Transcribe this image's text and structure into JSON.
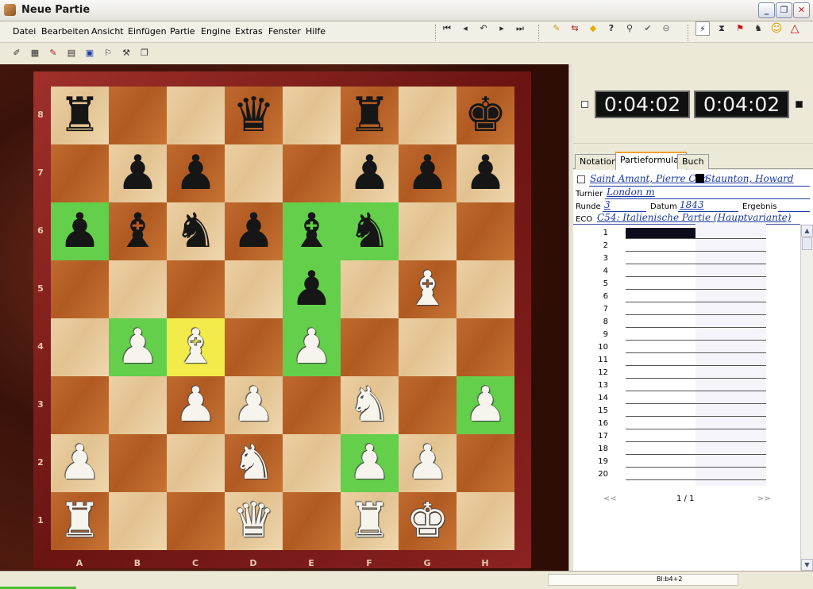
{
  "window": {
    "title": "Neue Partie",
    "min_glyph": "_",
    "max_glyph": "❐",
    "close_glyph": "✕"
  },
  "menu": [
    "Datei",
    "Bearbeiten",
    "Ansicht",
    "Einfügen",
    "Partie",
    "Engine",
    "Extras",
    "Fenster",
    "Hilfe"
  ],
  "nav_icons": [
    {
      "name": "first-move",
      "glyph": "⏮"
    },
    {
      "name": "prev-move",
      "glyph": "◂"
    },
    {
      "name": "takeback",
      "glyph": "↶"
    },
    {
      "name": "next-move",
      "glyph": "▸"
    },
    {
      "name": "last-move",
      "glyph": "⏭"
    }
  ],
  "tool_icons": [
    {
      "name": "new-game",
      "glyph": "✎"
    },
    {
      "name": "flip",
      "glyph": "⇆"
    },
    {
      "name": "hint",
      "glyph": "◆"
    },
    {
      "name": "analysis",
      "glyph": "?"
    },
    {
      "name": "search",
      "glyph": "⚲"
    },
    {
      "name": "accept",
      "glyph": "✔"
    },
    {
      "name": "resign",
      "glyph": "⊖"
    }
  ],
  "right_icons": [
    {
      "name": "engine",
      "glyph": "⚡"
    },
    {
      "name": "hourglass",
      "glyph": "⧗"
    },
    {
      "name": "flag",
      "glyph": "⚑"
    },
    {
      "name": "trainer",
      "glyph": "♞"
    },
    {
      "name": "smiley",
      "glyph": "☺"
    },
    {
      "name": "triangle",
      "glyph": "△"
    }
  ],
  "toolbar2_icons": [
    "✐",
    "▦",
    "✎",
    "▤",
    "▣",
    "⚐",
    "⚒",
    "❐"
  ],
  "board": {
    "ranks": [
      "8",
      "7",
      "6",
      "5",
      "4",
      "3",
      "2",
      "1"
    ],
    "files": [
      "A",
      "B",
      "C",
      "D",
      "E",
      "F",
      "G",
      "H"
    ],
    "rows": [
      [
        "bR",
        "",
        "",
        "bQ",
        "",
        "bR",
        "",
        "bK"
      ],
      [
        "",
        "bP",
        "bP",
        "",
        "",
        "bP",
        "bP",
        "bP"
      ],
      [
        "bP",
        "bB",
        "bN",
        "bP",
        "bB",
        "bN",
        "",
        ""
      ],
      [
        "",
        "",
        "",
        "",
        "bP",
        "",
        "wB",
        ""
      ],
      [
        "",
        "wP",
        "wB",
        "",
        "wP",
        "",
        "",
        ""
      ],
      [
        "",
        "",
        "wP",
        "wP",
        "",
        "wN",
        "",
        "wP"
      ],
      [
        "wP",
        "",
        "",
        "wN",
        "",
        "wP",
        "wP",
        ""
      ],
      [
        "wR",
        "",
        "",
        "wQ",
        "",
        "wR",
        "wK",
        ""
      ]
    ],
    "highlights": [
      {
        "sq": "a6",
        "color": "green"
      },
      {
        "sq": "b4",
        "color": "green"
      },
      {
        "sq": "c4",
        "color": "yellow"
      },
      {
        "sq": "e6",
        "color": "green"
      },
      {
        "sq": "e5",
        "color": "green"
      },
      {
        "sq": "e4",
        "color": "green"
      },
      {
        "sq": "f6",
        "color": "green"
      },
      {
        "sq": "f2",
        "color": "green"
      },
      {
        "sq": "h3",
        "color": "green"
      }
    ]
  },
  "clocks": {
    "white": "0:04:02",
    "black": "0:04:02"
  },
  "tabs": [
    "Notation",
    "Partieformular",
    "Buch"
  ],
  "active_tab": 1,
  "form": {
    "white_player": "Saint Amant, Pierre Cha",
    "black_player": "Staunton, Howard",
    "tournament_label": "Turnier",
    "tournament": "London m",
    "round_label": "Runde",
    "round": "3",
    "date_label": "Datum",
    "date": "1843",
    "result_label": "Ergebnis",
    "result": "",
    "eco_label": "ECO",
    "eco": "C54: Italienische Partie (Hauptvariante)"
  },
  "move_numbers": [
    "1",
    "2",
    "3",
    "4",
    "5",
    "6",
    "7",
    "8",
    "9",
    "10",
    "11",
    "12",
    "13",
    "14",
    "15",
    "16",
    "17",
    "18",
    "19",
    "20"
  ],
  "pager": {
    "prev": "<<",
    "page": "1 / 1",
    "next": ">>"
  },
  "status": {
    "text": "Bl:b4+2"
  }
}
